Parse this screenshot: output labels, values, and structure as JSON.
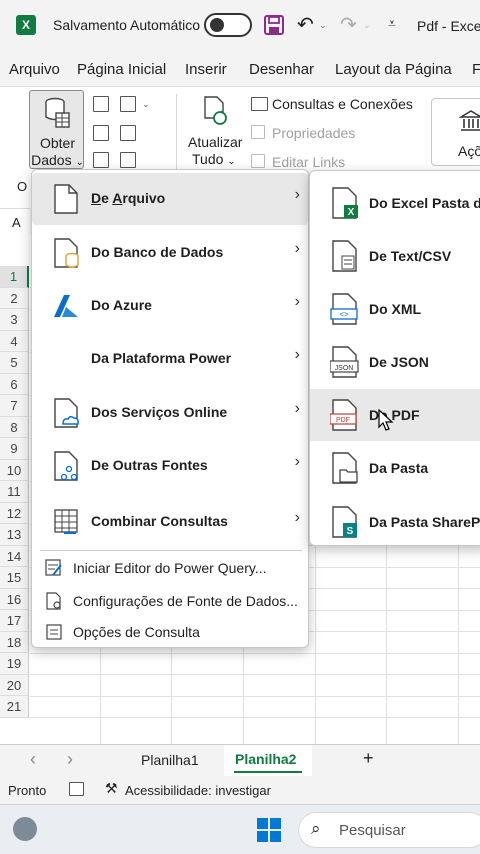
{
  "titlebar": {
    "autosave_label": "Salvamento Automático",
    "doc_title": "Pdf  -  Exce"
  },
  "menubar": [
    "Arquivo",
    "Página Inicial",
    "Inserir",
    "Desenhar",
    "Layout da Página",
    "F"
  ],
  "ribbon": {
    "obter_l1": "Obter",
    "obter_l2": "Dados",
    "obter_caret": "⌄",
    "atualizar_l1": "Atualizar",
    "atualizar_l2": "Tudo",
    "atualizar_caret": "⌄",
    "consultas": "Consultas e Conexões",
    "propriedades": "Propriedades",
    "editar_links": "Editar Links",
    "acoes": "Açõ",
    "group_cut": "O",
    "namebox_cut": "A",
    "caret_small": "⌄"
  },
  "rows": [
    "1",
    "2",
    "3",
    "4",
    "5",
    "6",
    "7",
    "8",
    "9",
    "10",
    "11",
    "12",
    "13",
    "14",
    "15",
    "16",
    "17",
    "18",
    "19",
    "20",
    "21"
  ],
  "menu": {
    "items": [
      {
        "label": "De Arquivo",
        "chev": "›"
      },
      {
        "label": "Do Banco de Dados",
        "chev": "›"
      },
      {
        "label": "Do Azure",
        "chev": "›"
      },
      {
        "label": "Da Plataforma Power",
        "chev": "›"
      },
      {
        "label": "Dos Serviços Online",
        "chev": "›"
      },
      {
        "label": "De Outras Fontes",
        "chev": "›"
      },
      {
        "label": "Combinar Consultas",
        "chev": "›"
      }
    ],
    "small_items": [
      {
        "label": "Iniciar Editor do Power Query..."
      },
      {
        "label": "Configurações de Fonte de Dados..."
      },
      {
        "label": "Opções de Consulta"
      }
    ]
  },
  "submenu": {
    "items": [
      {
        "label": "Do Excel Pasta de"
      },
      {
        "label": "De Text/CSV"
      },
      {
        "label": "Do XML"
      },
      {
        "label": "De JSON"
      },
      {
        "label": "Do PDF"
      },
      {
        "label": "Da Pasta"
      },
      {
        "label": "Da Pasta SharePoi"
      }
    ],
    "icon_labels": {
      "xml": "<>",
      "json": "JSON",
      "pdf": "PDF",
      "excel": "X",
      "sharepoint": "S"
    }
  },
  "tabs": {
    "prev": "‹",
    "next": "›",
    "sheets": [
      "Planilha1",
      "Planilha2"
    ],
    "active_index": 1,
    "add": "+"
  },
  "status": {
    "ready": "Pronto",
    "accessibility": "Acessibilidade: investigar"
  },
  "taskbar": {
    "search_placeholder": "Pesquisar"
  },
  "colors": {
    "excel_green": "#107c41",
    "save_purple": "#8b2c8b",
    "azure_blue": "#0a6ed1",
    "database_orange": "#e8a33d",
    "windows_blue": "#0078d4"
  }
}
